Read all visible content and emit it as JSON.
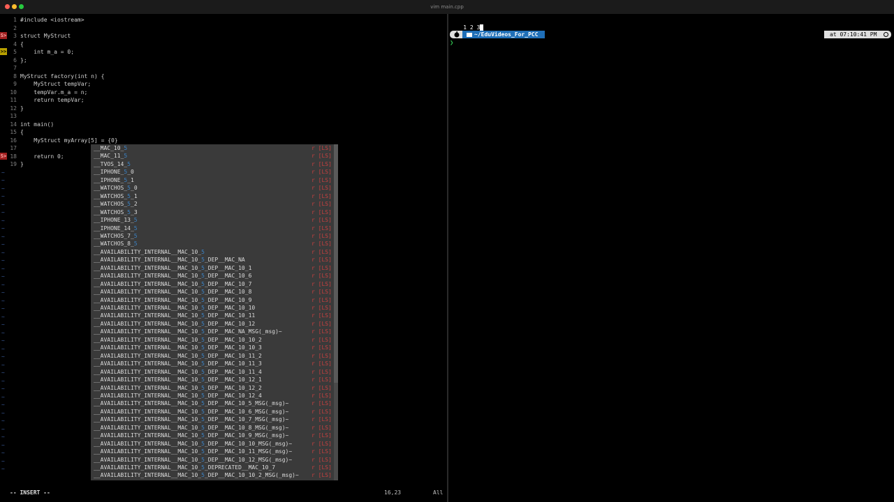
{
  "window": {
    "title": "vim main.cpp",
    "dot_colors": [
      "#ff5f56",
      "#ffbd2e",
      "#27c93f"
    ]
  },
  "editor": {
    "lines": [
      {
        "n": "1",
        "text": "#include <iostream>",
        "sign": ""
      },
      {
        "n": "2",
        "text": "",
        "sign": ""
      },
      {
        "n": "3",
        "text": "struct MyStruct",
        "sign": "err"
      },
      {
        "n": "4",
        "text": "{",
        "sign": ""
      },
      {
        "n": "5",
        "text": "    int m_a = 0;",
        "sign": "warn"
      },
      {
        "n": "6",
        "text": "};",
        "sign": ""
      },
      {
        "n": "7",
        "text": "",
        "sign": ""
      },
      {
        "n": "8",
        "text": "MyStruct factory(int n) {",
        "sign": ""
      },
      {
        "n": "9",
        "text": "    MyStruct tempVar;",
        "sign": ""
      },
      {
        "n": "10",
        "text": "    tempVar.m_a = n;",
        "sign": ""
      },
      {
        "n": "11",
        "text": "    return tempVar;",
        "sign": ""
      },
      {
        "n": "12",
        "text": "}",
        "sign": ""
      },
      {
        "n": "13",
        "text": "",
        "sign": ""
      },
      {
        "n": "14",
        "text": "int main()",
        "sign": ""
      },
      {
        "n": "15",
        "text": "{",
        "sign": ""
      },
      {
        "n": "16",
        "text": "    MyStruct myArray[5] = {0}",
        "sign": ""
      },
      {
        "n": "17",
        "text": "",
        "sign": ""
      },
      {
        "n": "18",
        "text": "    return 0;",
        "sign": "err"
      },
      {
        "n": "19",
        "text": "}",
        "sign": ""
      }
    ],
    "signs": {
      "err": "S>",
      "warn": ">>"
    },
    "tilde": "~"
  },
  "completion": {
    "kind_label": "r",
    "items": [
      {
        "pre": "__MAC_10_",
        "hl": "5",
        "post": "",
        "kind": "r [LS]"
      },
      {
        "pre": "__MAC_11_",
        "hl": "5",
        "post": "",
        "kind": "r [LS]"
      },
      {
        "pre": "__TVOS_14_",
        "hl": "5",
        "post": "",
        "kind": "r [LS]"
      },
      {
        "pre": "__IPHONE_",
        "hl": "5",
        "post": "_0",
        "kind": "r [LS]"
      },
      {
        "pre": "__IPHONE_",
        "hl": "5",
        "post": "_1",
        "kind": "r [LS]"
      },
      {
        "pre": "__WATCHOS_",
        "hl": "5",
        "post": "_0",
        "kind": "r [LS]"
      },
      {
        "pre": "__WATCHOS_",
        "hl": "5",
        "post": "_1",
        "kind": "r [LS]"
      },
      {
        "pre": "__WATCHOS_",
        "hl": "5",
        "post": "_2",
        "kind": "r [LS]"
      },
      {
        "pre": "__WATCHOS_",
        "hl": "5",
        "post": "_3",
        "kind": "r [LS]"
      },
      {
        "pre": "__IPHONE_13_",
        "hl": "5",
        "post": "",
        "kind": "r [LS]"
      },
      {
        "pre": "__IPHONE_14_",
        "hl": "5",
        "post": "",
        "kind": "r [LS]"
      },
      {
        "pre": "__WATCHOS_7_",
        "hl": "5",
        "post": "",
        "kind": "r [LS]"
      },
      {
        "pre": "__WATCHOS_8_",
        "hl": "5",
        "post": "",
        "kind": "r [LS]"
      },
      {
        "pre": "__AVAILABILITY_INTERNAL__MAC_10_",
        "hl": "5",
        "post": "",
        "kind": "r [LS]"
      },
      {
        "pre": "__AVAILABILITY_INTERNAL__MAC_10_",
        "hl": "5",
        "post": "_DEP__MAC_NA",
        "kind": "r [LS]"
      },
      {
        "pre": "__AVAILABILITY_INTERNAL__MAC_10_",
        "hl": "5",
        "post": "_DEP__MAC_10_1",
        "kind": "r [LS]"
      },
      {
        "pre": "__AVAILABILITY_INTERNAL__MAC_10_",
        "hl": "5",
        "post": "_DEP__MAC_10_6",
        "kind": "r [LS]"
      },
      {
        "pre": "__AVAILABILITY_INTERNAL__MAC_10_",
        "hl": "5",
        "post": "_DEP__MAC_10_7",
        "kind": "r [LS]"
      },
      {
        "pre": "__AVAILABILITY_INTERNAL__MAC_10_",
        "hl": "5",
        "post": "_DEP__MAC_10_8",
        "kind": "r [LS]"
      },
      {
        "pre": "__AVAILABILITY_INTERNAL__MAC_10_",
        "hl": "5",
        "post": "_DEP__MAC_10_9",
        "kind": "r [LS]"
      },
      {
        "pre": "__AVAILABILITY_INTERNAL__MAC_10_",
        "hl": "5",
        "post": "_DEP__MAC_10_10",
        "kind": "r [LS]"
      },
      {
        "pre": "__AVAILABILITY_INTERNAL__MAC_10_",
        "hl": "5",
        "post": "_DEP__MAC_10_11",
        "kind": "r [LS]"
      },
      {
        "pre": "__AVAILABILITY_INTERNAL__MAC_10_",
        "hl": "5",
        "post": "_DEP__MAC_10_12",
        "kind": "r [LS]"
      },
      {
        "pre": "__AVAILABILITY_INTERNAL__MAC_10_",
        "hl": "5",
        "post": "_DEP__MAC_NA_MSG(_msg)~",
        "kind": "r [LS]"
      },
      {
        "pre": "__AVAILABILITY_INTERNAL__MAC_10_",
        "hl": "5",
        "post": "_DEP__MAC_10_10_2",
        "kind": "r [LS]"
      },
      {
        "pre": "__AVAILABILITY_INTERNAL__MAC_10_",
        "hl": "5",
        "post": "_DEP__MAC_10_10_3",
        "kind": "r [LS]"
      },
      {
        "pre": "__AVAILABILITY_INTERNAL__MAC_10_",
        "hl": "5",
        "post": "_DEP__MAC_10_11_2",
        "kind": "r [LS]"
      },
      {
        "pre": "__AVAILABILITY_INTERNAL__MAC_10_",
        "hl": "5",
        "post": "_DEP__MAC_10_11_3",
        "kind": "r [LS]"
      },
      {
        "pre": "__AVAILABILITY_INTERNAL__MAC_10_",
        "hl": "5",
        "post": "_DEP__MAC_10_11_4",
        "kind": "r [LS]"
      },
      {
        "pre": "__AVAILABILITY_INTERNAL__MAC_10_",
        "hl": "5",
        "post": "_DEP__MAC_10_12_1",
        "kind": "r [LS]"
      },
      {
        "pre": "__AVAILABILITY_INTERNAL__MAC_10_",
        "hl": "5",
        "post": "_DEP__MAC_10_12_2",
        "kind": "r [LS]"
      },
      {
        "pre": "__AVAILABILITY_INTERNAL__MAC_10_",
        "hl": "5",
        "post": "_DEP__MAC_10_12_4",
        "kind": "r [LS]"
      },
      {
        "pre": "__AVAILABILITY_INTERNAL__MAC_10_",
        "hl": "5",
        "post": "_DEP__MAC_10_5_MSG(_msg)~",
        "kind": "r [LS]"
      },
      {
        "pre": "__AVAILABILITY_INTERNAL__MAC_10_",
        "hl": "5",
        "post": "_DEP__MAC_10_6_MSG(_msg)~",
        "kind": "r [LS]"
      },
      {
        "pre": "__AVAILABILITY_INTERNAL__MAC_10_",
        "hl": "5",
        "post": "_DEP__MAC_10_7_MSG(_msg)~",
        "kind": "r [LS]"
      },
      {
        "pre": "__AVAILABILITY_INTERNAL__MAC_10_",
        "hl": "5",
        "post": "_DEP__MAC_10_8_MSG(_msg)~",
        "kind": "r [LS]"
      },
      {
        "pre": "__AVAILABILITY_INTERNAL__MAC_10_",
        "hl": "5",
        "post": "_DEP__MAC_10_9_MSG(_msg)~",
        "kind": "r [LS]"
      },
      {
        "pre": "__AVAILABILITY_INTERNAL__MAC_10_",
        "hl": "5",
        "post": "_DEP__MAC_10_10_MSG(_msg)~",
        "kind": "r [LS]"
      },
      {
        "pre": "__AVAILABILITY_INTERNAL__MAC_10_",
        "hl": "5",
        "post": "_DEP__MAC_10_11_MSG(_msg)~",
        "kind": "r [LS]"
      },
      {
        "pre": "__AVAILABILITY_INTERNAL__MAC_10_",
        "hl": "5",
        "post": "_DEP__MAC_10_12_MSG(_msg)~",
        "kind": "r [LS]"
      },
      {
        "pre": "__AVAILABILITY_INTERNAL__MAC_10_",
        "hl": "5",
        "post": "_DEPRECATED__MAC_10_7",
        "kind": "r [LS]"
      },
      {
        "pre": "__AVAILABILITY_INTERNAL__MAC_10_",
        "hl": "5",
        "post": "_DEP__MAC_10_10_2_MSG(_msg)~",
        "kind": "r [LS]"
      }
    ]
  },
  "status": {
    "mode": "-- INSERT --",
    "position": "16,23",
    "scroll": "All"
  },
  "terminal": {
    "first_line": "1 2 3",
    "path": "~/EduVideos_For_PCC",
    "time": "at 07:10:41 PM",
    "prompt": "❯",
    "apple_icon": "apple-icon",
    "folder_icon": "folder-icon",
    "clock_icon": "clock-icon"
  }
}
